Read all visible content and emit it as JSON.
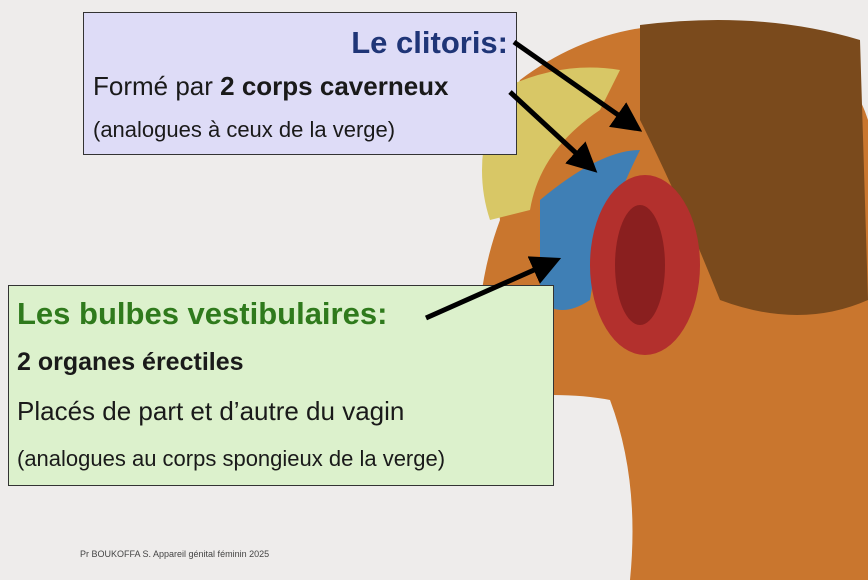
{
  "top_box": {
    "title": "Le clitoris:",
    "line1_prefix": "Formé par ",
    "line1_bold": "2 corps caverneux",
    "line2": "(analogues à ceux de la verge)"
  },
  "bottom_box": {
    "title": "Les bulbes vestibulaires:",
    "line1": "2 organes érectiles",
    "line2": "Placés de part et d’autre du vagin",
    "line3": "(analogues au corps spongieux de la verge)"
  },
  "footer": "Pr BOUKOFFA S. Appareil génital féminin 2025",
  "colors": {
    "title_blue": "#1f3577",
    "title_green": "#2f7a1c",
    "top_box_bg": "#dedcf7",
    "bottom_box_bg": "#dcf1cc"
  }
}
